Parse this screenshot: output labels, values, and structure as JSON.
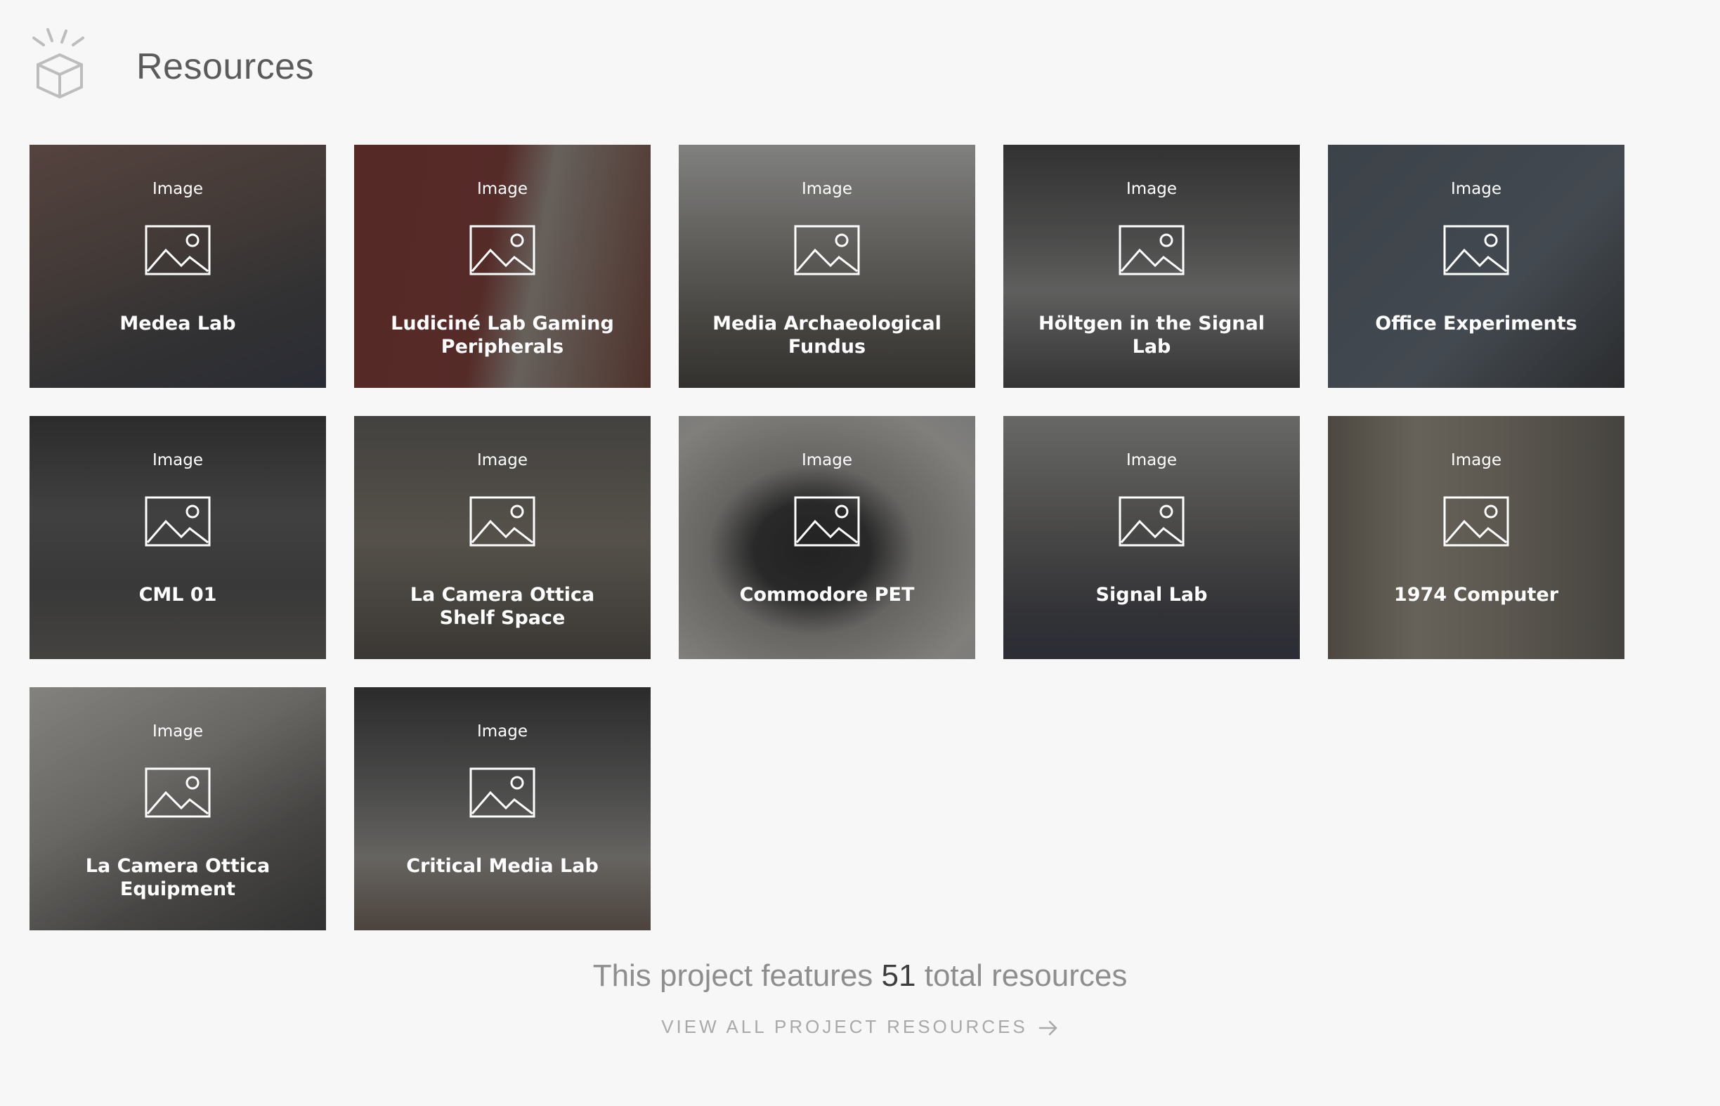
{
  "header": {
    "title": "Resources",
    "icon": "resource-box-icon"
  },
  "resources": [
    {
      "type": "Image",
      "title": "Medea Lab"
    },
    {
      "type": "Image",
      "title": "Ludiciné Lab Gaming Peripherals"
    },
    {
      "type": "Image",
      "title": "Media Archaeological Fundus"
    },
    {
      "type": "Image",
      "title": "Höltgen in the Signal Lab"
    },
    {
      "type": "Image",
      "title": "Office Experiments"
    },
    {
      "type": "Image",
      "title": "CML 01"
    },
    {
      "type": "Image",
      "title": "La Camera Ottica Shelf Space"
    },
    {
      "type": "Image",
      "title": "Commodore PET"
    },
    {
      "type": "Image",
      "title": "Signal Lab"
    },
    {
      "type": "Image",
      "title": "1974 Computer"
    },
    {
      "type": "Image",
      "title": "La Camera Ottica Equipment"
    },
    {
      "type": "Image",
      "title": "Critical Media Lab"
    }
  ],
  "footer": {
    "prefix": "This project features",
    "count": "51",
    "suffix": "total resources",
    "link_label": "VIEW ALL PROJECT RESOURCES",
    "link_icon": "arrow-right-icon"
  },
  "colors": {
    "background": "#f7f7f7",
    "title_text": "#5b5b5b",
    "muted_text": "#8e8e8e",
    "link_text": "#a9a9a9"
  }
}
